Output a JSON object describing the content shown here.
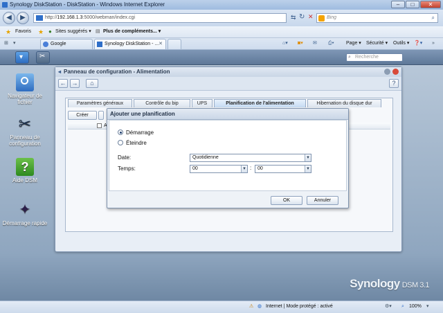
{
  "browser": {
    "window_title": "Synology DiskStation - DiskStation - Windows Internet Explorer",
    "address_prefix": "http://",
    "address_host": "192.168.1.3",
    "address_rest": ":5000/webman/index.cgi",
    "search_placeholder": "Bing",
    "favorites_label": "Favoris",
    "suggested_sites": "Sites suggérés ▾",
    "more_addons": "Plus de compléments... ▾",
    "tabs": [
      {
        "label": "Google"
      },
      {
        "label": "Synology DiskStation - ..."
      }
    ],
    "command_bar": {
      "page": "Page ▾",
      "security": "Sécurité ▾",
      "tools": "Outils ▾"
    },
    "status": {
      "zone": "Internet | Mode protégé : activé",
      "zoom": "100%"
    }
  },
  "dsm": {
    "search_placeholder": "Recherche",
    "desktop_items": [
      {
        "label": "Navigateur de fichier"
      },
      {
        "label": "Panneau de configuration"
      },
      {
        "label": "Aide DSM"
      },
      {
        "label": "Démarrage rapide"
      }
    ],
    "brand": {
      "name": "Synology",
      "version": "DSM 3.1"
    }
  },
  "control_panel": {
    "title": "Panneau de configuration - Alimentation",
    "tabs": [
      {
        "label": "Paramètres généraux"
      },
      {
        "label": "Contrôle du bip"
      },
      {
        "label": "UPS"
      },
      {
        "label": "Planification de l'alimentation"
      },
      {
        "label": "Hibernation du disque dur"
      }
    ],
    "create_button": "Créer",
    "grid_header_first": "A"
  },
  "dialog": {
    "title": "Ajouter une planification",
    "options": [
      {
        "label": "Démarrage",
        "checked": true
      },
      {
        "label": "Éteindre",
        "checked": false
      }
    ],
    "date_label": "Date:",
    "date_value": "Quotidienne",
    "time_label": "Temps:",
    "hour_value": "00",
    "separator": ":",
    "minute_value": "00",
    "ok_button": "OK",
    "cancel_button": "Annuler"
  }
}
